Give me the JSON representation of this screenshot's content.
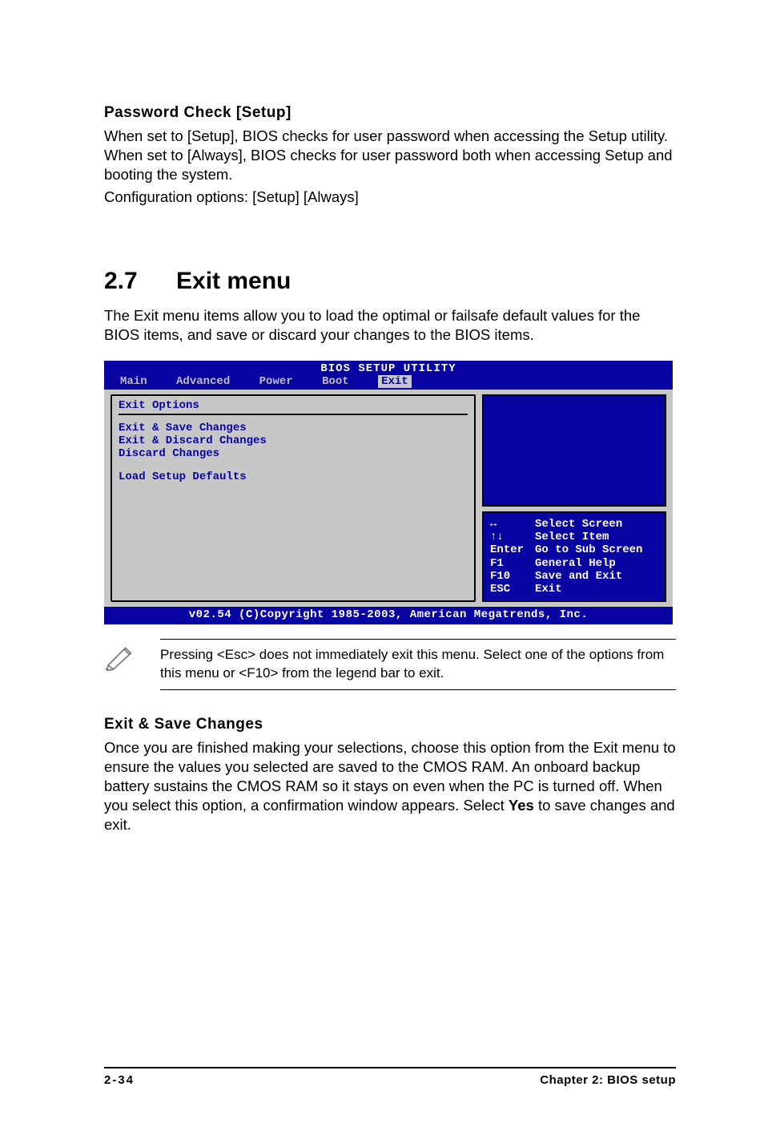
{
  "section_password": {
    "title": "Password Check [Setup]",
    "para1": "When set to [Setup], BIOS checks for user password when accessing the Setup utility. When set to [Always], BIOS checks for user password both when accessing Setup and booting the system.",
    "para2": "Configuration options: [Setup] [Always]"
  },
  "section_exit_menu": {
    "number": "2.7",
    "title": "Exit menu",
    "intro": "The Exit menu items allow you to load the optimal or failsafe default values for the BIOS items, and save or discard your changes to the BIOS items."
  },
  "bios": {
    "title": "BIOS SETUP UTILITY",
    "menubar": [
      "Main",
      "Advanced",
      "Power",
      "Boot",
      "Exit"
    ],
    "selected_index": 4,
    "group_title": "Exit Options",
    "items": [
      "Exit & Save Changes",
      "Exit & Discard Changes",
      "Discard Changes",
      "",
      "Load Setup Defaults"
    ],
    "legend": [
      {
        "key": "↔",
        "action": "Select Screen"
      },
      {
        "key": "↑↓",
        "action": "Select Item"
      },
      {
        "key": "Enter",
        "action": "Go to Sub Screen"
      },
      {
        "key": "F1",
        "action": "General Help"
      },
      {
        "key": "F10",
        "action": "Save and Exit"
      },
      {
        "key": "ESC",
        "action": "Exit"
      }
    ],
    "footer": "v02.54 (C)Copyright 1985-2003, American Megatrends, Inc."
  },
  "note": {
    "text": "Pressing <Esc> does not immediately exit this menu. Select one of the options from this menu or <F10> from the legend bar to exit."
  },
  "section_exit_save": {
    "title": "Exit & Save Changes",
    "para_pre": "Once you are finished making your selections, choose this option from the Exit menu to ensure the values you selected are saved to the CMOS RAM. An onboard backup battery sustains the CMOS RAM so it stays on even when the PC is turned off. When you select this option, a confirmation window appears. Select ",
    "yes": "Yes",
    "para_post": " to save changes and exit."
  },
  "page_footer": {
    "left": "2-34",
    "right": "Chapter 2: BIOS setup"
  }
}
